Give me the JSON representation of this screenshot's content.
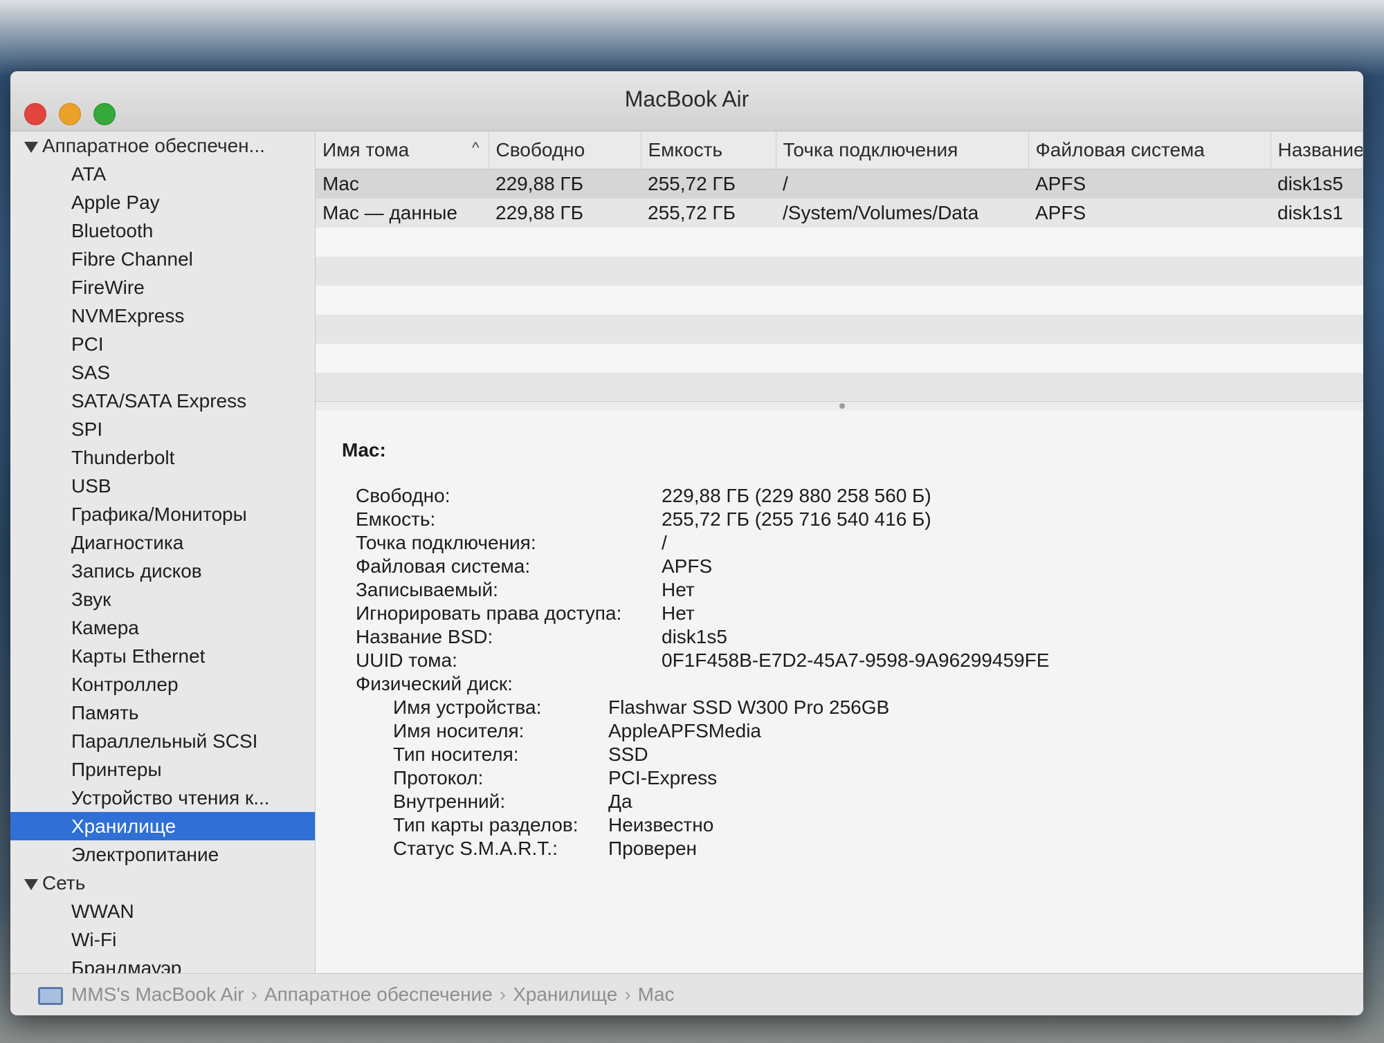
{
  "window": {
    "title": "MacBook Air"
  },
  "sidebar": {
    "group_hardware": "Аппаратное обеспечен...",
    "hardware_items": [
      "ATA",
      "Apple Pay",
      "Bluetooth",
      "Fibre Channel",
      "FireWire",
      "NVMExpress",
      "PCI",
      "SAS",
      "SATA/SATA Express",
      "SPI",
      "Thunderbolt",
      "USB",
      "Графика/Мониторы",
      "Диагностика",
      "Запись дисков",
      "Звук",
      "Камера",
      "Карты Ethernet",
      "Контроллер",
      "Память",
      "Параллельный SCSI",
      "Принтеры",
      "Устройство чтения к...",
      "Хранилище",
      "Электропитание"
    ],
    "selected": "Хранилище",
    "group_network": "Сеть",
    "network_items": [
      "WWAN",
      "Wi-Fi",
      "Брандмауэр"
    ]
  },
  "table": {
    "columns": [
      "Имя тома",
      "Свободно",
      "Емкость",
      "Точка подключения",
      "Файловая система",
      "Название"
    ],
    "sort_indicator": "^",
    "rows": [
      [
        "Mac",
        "229,88 ГБ",
        "255,72 ГБ",
        "/",
        "APFS",
        "disk1s5"
      ],
      [
        "Mac — данные",
        "229,88 ГБ",
        "255,72 ГБ",
        "/System/Volumes/Data",
        "APFS",
        "disk1s1"
      ]
    ]
  },
  "detail": {
    "title": "Mac:",
    "fields": [
      {
        "label": "Свободно:",
        "value": "229,88 ГБ (229 880 258 560 Б)"
      },
      {
        "label": "Емкость:",
        "value": "255,72 ГБ (255 716 540 416 Б)"
      },
      {
        "label": "Точка подключения:",
        "value": "/"
      },
      {
        "label": "Файловая система:",
        "value": "APFS"
      },
      {
        "label": "Записываемый:",
        "value": "Нет"
      },
      {
        "label": "Игнорировать права доступа:",
        "value": "Нет"
      },
      {
        "label": "Название BSD:",
        "value": "disk1s5"
      },
      {
        "label": "UUID тома:",
        "value": "0F1F458B-E7D2-45A7-9598-9A96299459FE"
      }
    ],
    "physical_label": "Физический диск:",
    "physical_fields": [
      {
        "label": "Имя устройства:",
        "value": "Flashwar SSD W300 Pro 256GB"
      },
      {
        "label": "Имя носителя:",
        "value": "AppleAPFSMedia"
      },
      {
        "label": "Тип носителя:",
        "value": "SSD"
      },
      {
        "label": "Протокол:",
        "value": "PCI-Express"
      },
      {
        "label": "Внутренний:",
        "value": "Да"
      },
      {
        "label": "Тип карты разделов:",
        "value": "Неизвестно"
      },
      {
        "label": "Статус S.M.A.R.T.:",
        "value": "Проверен"
      }
    ]
  },
  "breadcrumb": [
    "MMS's MacBook Air",
    "Аппаратное обеспечение",
    "Хранилище",
    "Mac"
  ]
}
